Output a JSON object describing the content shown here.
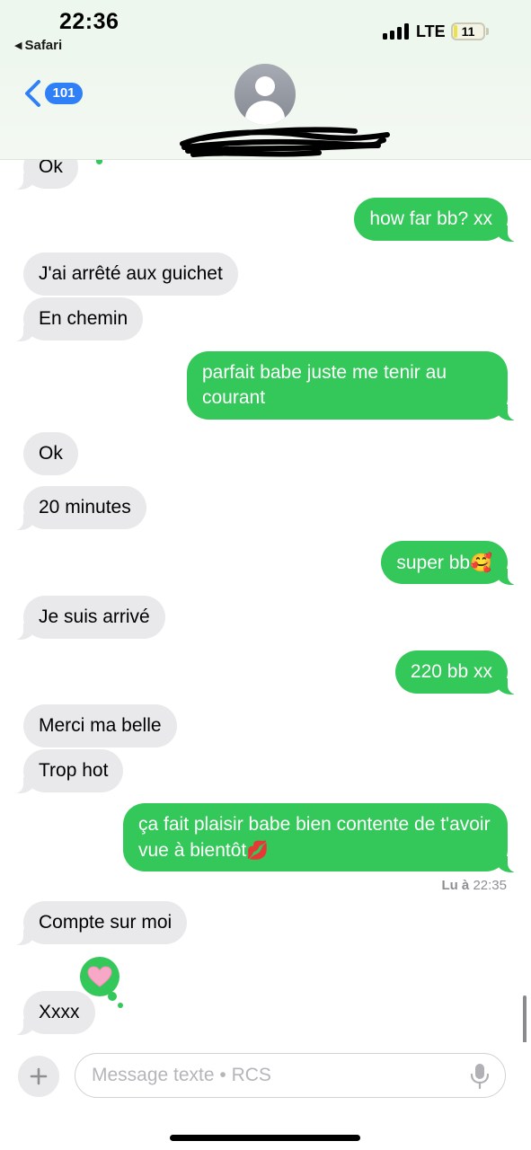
{
  "status_bar": {
    "time": "22:36",
    "back_app": "Safari",
    "network": "LTE",
    "battery": "11",
    "battery_level": 0.11
  },
  "header": {
    "back_badge": "101"
  },
  "messages": [
    {
      "from": "them",
      "text": "Ok"
    },
    {
      "from": "me",
      "text": "how far bb? xx"
    },
    {
      "from": "them",
      "text": "J'ai arrêté aux guichet"
    },
    {
      "from": "them",
      "text": "En chemin"
    },
    {
      "from": "me",
      "text": "parfait babe juste me tenir au courant"
    },
    {
      "from": "them",
      "text": "Ok"
    },
    {
      "from": "them",
      "text": "20 minutes"
    },
    {
      "from": "me",
      "text": "super bb",
      "emoji": "🥰"
    },
    {
      "from": "them",
      "text": "Je suis arrivé"
    },
    {
      "from": "me",
      "text": "220 bb xx"
    },
    {
      "from": "them",
      "text": "Merci ma belle"
    },
    {
      "from": "them",
      "text": "Trop hot"
    },
    {
      "from": "me",
      "text": "ça fait plaisir babe bien contente de t'avoir vue à bientôt",
      "emoji": "💋"
    },
    {
      "from": "them",
      "text": "Compte sur moi"
    },
    {
      "from": "them",
      "text": "Xxxx",
      "tapback": "heart"
    }
  ],
  "read_receipt": {
    "label": "Lu à",
    "time": "22:35"
  },
  "composer": {
    "placeholder": "Message texte • RCS"
  },
  "colors": {
    "sent_bubble": "#34c759",
    "received_bubble": "#e9e9eb",
    "badge": "#2f7ff6"
  }
}
